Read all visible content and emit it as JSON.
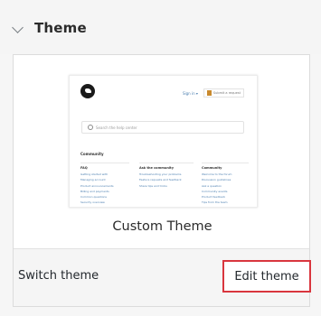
{
  "section": {
    "title": "Theme"
  },
  "theme_card": {
    "name": "Custom Theme",
    "switch_label": "Switch theme",
    "edit_label": "Edit theme",
    "highlight_color": "#d9363e"
  },
  "preview": {
    "top_link": "Sign in  ▾",
    "badge_text": "Submit a request",
    "search_placeholder": "Search the help center",
    "section_title": "Community",
    "columns": [
      {
        "heading": "FAQ",
        "items": [
          "Getting started with",
          "Managing account",
          "Product announcements",
          "Billing and payments",
          "Common questions",
          "Security overview"
        ]
      },
      {
        "heading": "Ask the community",
        "items": [
          "Troubleshooting your problems",
          "Feature requests and feedback",
          "Share tips and tricks"
        ]
      },
      {
        "heading": "Community",
        "items": [
          "Welcome to the forum",
          "Discussion guidelines",
          "Ask a question",
          "Community events",
          "Product feedback",
          "Tips from the team"
        ]
      }
    ]
  }
}
